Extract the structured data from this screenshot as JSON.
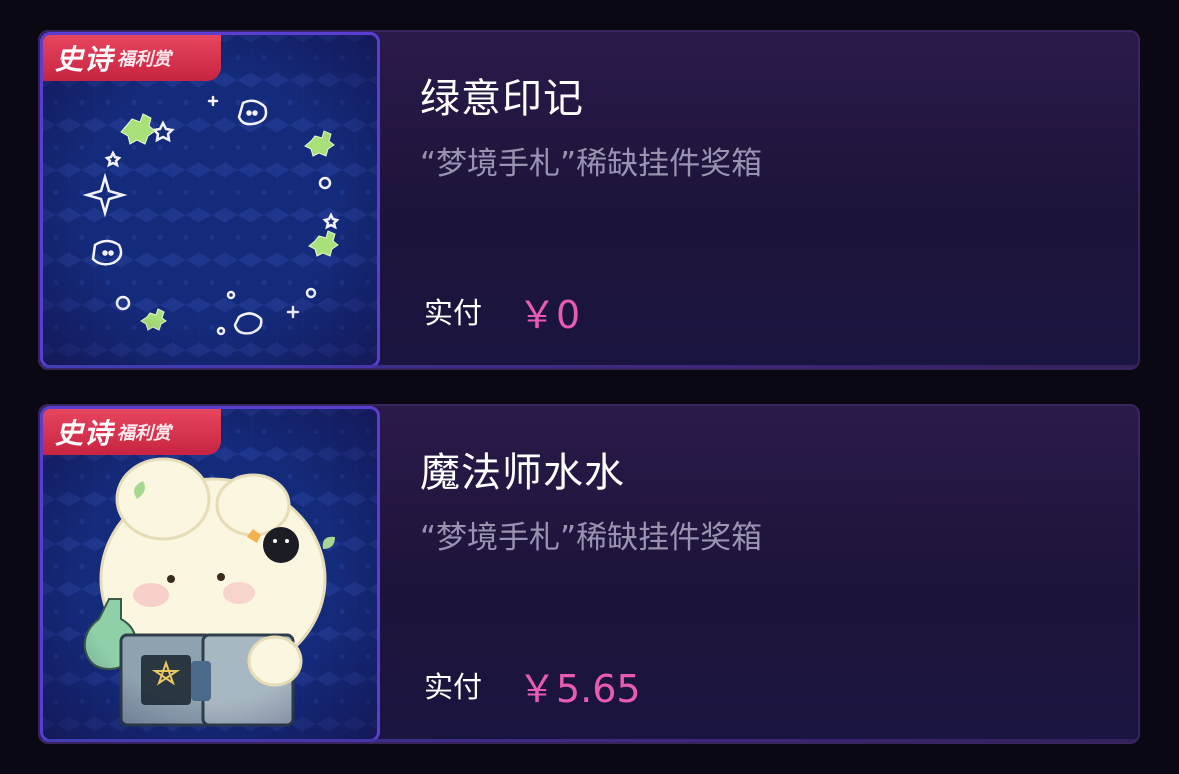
{
  "items": [
    {
      "badge_big": "史诗",
      "badge_small": "福利赏",
      "title": "绿意印记",
      "subtitle": "“梦境手札”稀缺挂件奖箱",
      "paid_label": "实付",
      "price": "￥0"
    },
    {
      "badge_big": "史诗",
      "badge_small": "福利赏",
      "title": "魔法师水水",
      "subtitle": "“梦境手札”稀缺挂件奖箱",
      "paid_label": "实付",
      "price": "￥5.65"
    }
  ],
  "colors": {
    "background": "#0a0813",
    "card_bg": "#231843",
    "thumb_bg": "#142a7a",
    "badge": "#d62f4c",
    "price": "#e85bb4",
    "subtitle": "#9a93b0"
  },
  "icons": [
    "frame-wreath-icon",
    "bunny-wizard-icon"
  ]
}
